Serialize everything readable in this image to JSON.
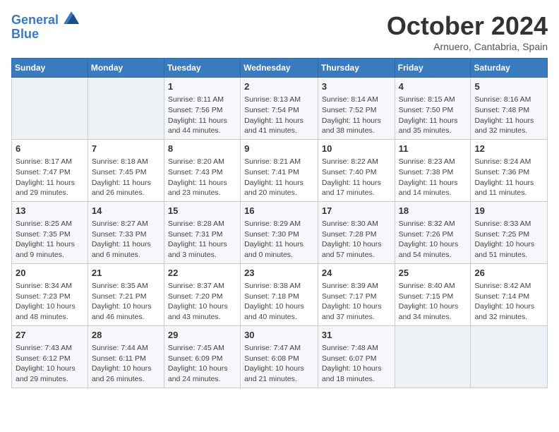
{
  "header": {
    "logo_line1": "General",
    "logo_line2": "Blue",
    "month_title": "October 2024",
    "location": "Arnuero, Cantabria, Spain"
  },
  "days_of_week": [
    "Sunday",
    "Monday",
    "Tuesday",
    "Wednesday",
    "Thursday",
    "Friday",
    "Saturday"
  ],
  "weeks": [
    [
      {
        "day": "",
        "detail": ""
      },
      {
        "day": "",
        "detail": ""
      },
      {
        "day": "1",
        "detail": "Sunrise: 8:11 AM\nSunset: 7:56 PM\nDaylight: 11 hours and 44 minutes."
      },
      {
        "day": "2",
        "detail": "Sunrise: 8:13 AM\nSunset: 7:54 PM\nDaylight: 11 hours and 41 minutes."
      },
      {
        "day": "3",
        "detail": "Sunrise: 8:14 AM\nSunset: 7:52 PM\nDaylight: 11 hours and 38 minutes."
      },
      {
        "day": "4",
        "detail": "Sunrise: 8:15 AM\nSunset: 7:50 PM\nDaylight: 11 hours and 35 minutes."
      },
      {
        "day": "5",
        "detail": "Sunrise: 8:16 AM\nSunset: 7:48 PM\nDaylight: 11 hours and 32 minutes."
      }
    ],
    [
      {
        "day": "6",
        "detail": "Sunrise: 8:17 AM\nSunset: 7:47 PM\nDaylight: 11 hours and 29 minutes."
      },
      {
        "day": "7",
        "detail": "Sunrise: 8:18 AM\nSunset: 7:45 PM\nDaylight: 11 hours and 26 minutes."
      },
      {
        "day": "8",
        "detail": "Sunrise: 8:20 AM\nSunset: 7:43 PM\nDaylight: 11 hours and 23 minutes."
      },
      {
        "day": "9",
        "detail": "Sunrise: 8:21 AM\nSunset: 7:41 PM\nDaylight: 11 hours and 20 minutes."
      },
      {
        "day": "10",
        "detail": "Sunrise: 8:22 AM\nSunset: 7:40 PM\nDaylight: 11 hours and 17 minutes."
      },
      {
        "day": "11",
        "detail": "Sunrise: 8:23 AM\nSunset: 7:38 PM\nDaylight: 11 hours and 14 minutes."
      },
      {
        "day": "12",
        "detail": "Sunrise: 8:24 AM\nSunset: 7:36 PM\nDaylight: 11 hours and 11 minutes."
      }
    ],
    [
      {
        "day": "13",
        "detail": "Sunrise: 8:25 AM\nSunset: 7:35 PM\nDaylight: 11 hours and 9 minutes."
      },
      {
        "day": "14",
        "detail": "Sunrise: 8:27 AM\nSunset: 7:33 PM\nDaylight: 11 hours and 6 minutes."
      },
      {
        "day": "15",
        "detail": "Sunrise: 8:28 AM\nSunset: 7:31 PM\nDaylight: 11 hours and 3 minutes."
      },
      {
        "day": "16",
        "detail": "Sunrise: 8:29 AM\nSunset: 7:30 PM\nDaylight: 11 hours and 0 minutes."
      },
      {
        "day": "17",
        "detail": "Sunrise: 8:30 AM\nSunset: 7:28 PM\nDaylight: 10 hours and 57 minutes."
      },
      {
        "day": "18",
        "detail": "Sunrise: 8:32 AM\nSunset: 7:26 PM\nDaylight: 10 hours and 54 minutes."
      },
      {
        "day": "19",
        "detail": "Sunrise: 8:33 AM\nSunset: 7:25 PM\nDaylight: 10 hours and 51 minutes."
      }
    ],
    [
      {
        "day": "20",
        "detail": "Sunrise: 8:34 AM\nSunset: 7:23 PM\nDaylight: 10 hours and 48 minutes."
      },
      {
        "day": "21",
        "detail": "Sunrise: 8:35 AM\nSunset: 7:21 PM\nDaylight: 10 hours and 46 minutes."
      },
      {
        "day": "22",
        "detail": "Sunrise: 8:37 AM\nSunset: 7:20 PM\nDaylight: 10 hours and 43 minutes."
      },
      {
        "day": "23",
        "detail": "Sunrise: 8:38 AM\nSunset: 7:18 PM\nDaylight: 10 hours and 40 minutes."
      },
      {
        "day": "24",
        "detail": "Sunrise: 8:39 AM\nSunset: 7:17 PM\nDaylight: 10 hours and 37 minutes."
      },
      {
        "day": "25",
        "detail": "Sunrise: 8:40 AM\nSunset: 7:15 PM\nDaylight: 10 hours and 34 minutes."
      },
      {
        "day": "26",
        "detail": "Sunrise: 8:42 AM\nSunset: 7:14 PM\nDaylight: 10 hours and 32 minutes."
      }
    ],
    [
      {
        "day": "27",
        "detail": "Sunrise: 7:43 AM\nSunset: 6:12 PM\nDaylight: 10 hours and 29 minutes."
      },
      {
        "day": "28",
        "detail": "Sunrise: 7:44 AM\nSunset: 6:11 PM\nDaylight: 10 hours and 26 minutes."
      },
      {
        "day": "29",
        "detail": "Sunrise: 7:45 AM\nSunset: 6:09 PM\nDaylight: 10 hours and 24 minutes."
      },
      {
        "day": "30",
        "detail": "Sunrise: 7:47 AM\nSunset: 6:08 PM\nDaylight: 10 hours and 21 minutes."
      },
      {
        "day": "31",
        "detail": "Sunrise: 7:48 AM\nSunset: 6:07 PM\nDaylight: 10 hours and 18 minutes."
      },
      {
        "day": "",
        "detail": ""
      },
      {
        "day": "",
        "detail": ""
      }
    ]
  ]
}
